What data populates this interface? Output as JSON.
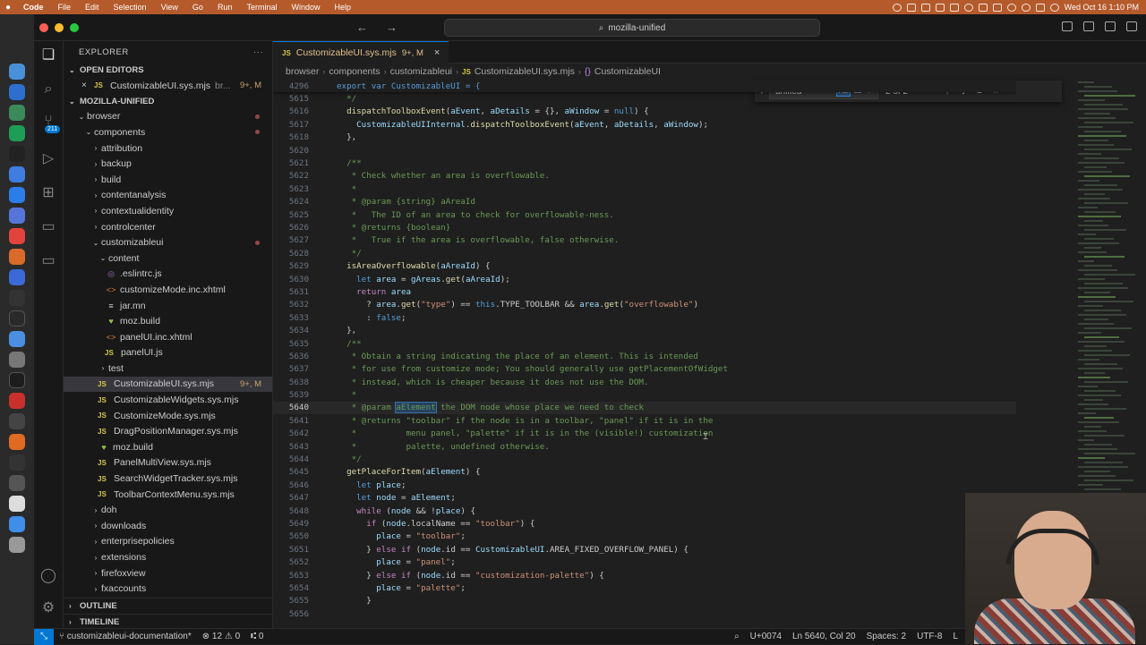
{
  "menubar": {
    "app": "Code",
    "items": [
      "File",
      "Edit",
      "Selection",
      "View",
      "Go",
      "Run",
      "Terminal",
      "Window",
      "Help"
    ],
    "datetime": "Wed Oct 16  1:10 PM"
  },
  "titlebar": {
    "search_text": "mozilla-unified"
  },
  "activity": {
    "scm_badge": "211"
  },
  "sidebar": {
    "title": "EXPLORER",
    "open_editors_label": "OPEN EDITORS",
    "open_editor": {
      "name": "CustomizableUI.sys.mjs",
      "desc": "br...",
      "status": "9+, M"
    },
    "workspace_label": "MOZILLA-UNIFIED",
    "tree": [
      {
        "name": "browser",
        "indent": 1,
        "kind": "folder",
        "open": true,
        "color": "red",
        "dot": true
      },
      {
        "name": "components",
        "indent": 2,
        "kind": "folder",
        "open": true,
        "color": "red",
        "dot": true
      },
      {
        "name": "attribution",
        "indent": 3,
        "kind": "folder",
        "open": false
      },
      {
        "name": "backup",
        "indent": 3,
        "kind": "folder",
        "open": false
      },
      {
        "name": "build",
        "indent": 3,
        "kind": "folder",
        "open": false
      },
      {
        "name": "contentanalysis",
        "indent": 3,
        "kind": "folder",
        "open": false
      },
      {
        "name": "contextualidentity",
        "indent": 3,
        "kind": "folder",
        "open": false
      },
      {
        "name": "controlcenter",
        "indent": 3,
        "kind": "folder",
        "open": false
      },
      {
        "name": "customizableui",
        "indent": 3,
        "kind": "folder",
        "open": true,
        "color": "red",
        "dot": true
      },
      {
        "name": "content",
        "indent": 4,
        "kind": "folder",
        "open": true
      },
      {
        "name": ".eslintrc.js",
        "indent": 5,
        "kind": "eslint"
      },
      {
        "name": "customizeMode.inc.xhtml",
        "indent": 5,
        "kind": "xml"
      },
      {
        "name": "jar.mn",
        "indent": 5,
        "kind": "file"
      },
      {
        "name": "moz.build",
        "indent": 5,
        "kind": "heart"
      },
      {
        "name": "panelUI.inc.xhtml",
        "indent": 5,
        "kind": "xml"
      },
      {
        "name": "panelUI.js",
        "indent": 5,
        "kind": "js"
      },
      {
        "name": "test",
        "indent": 4,
        "kind": "folder",
        "open": false
      },
      {
        "name": "CustomizableUI.sys.mjs",
        "indent": 4,
        "kind": "js",
        "selected": true,
        "meta": "9+, M",
        "color": "mod"
      },
      {
        "name": "CustomizableWidgets.sys.mjs",
        "indent": 4,
        "kind": "js"
      },
      {
        "name": "CustomizeMode.sys.mjs",
        "indent": 4,
        "kind": "js"
      },
      {
        "name": "DragPositionManager.sys.mjs",
        "indent": 4,
        "kind": "js"
      },
      {
        "name": "moz.build",
        "indent": 4,
        "kind": "heart"
      },
      {
        "name": "PanelMultiView.sys.mjs",
        "indent": 4,
        "kind": "js"
      },
      {
        "name": "SearchWidgetTracker.sys.mjs",
        "indent": 4,
        "kind": "js"
      },
      {
        "name": "ToolbarContextMenu.sys.mjs",
        "indent": 4,
        "kind": "js"
      },
      {
        "name": "doh",
        "indent": 3,
        "kind": "folder",
        "open": false
      },
      {
        "name": "downloads",
        "indent": 3,
        "kind": "folder",
        "open": false
      },
      {
        "name": "enterprisepolicies",
        "indent": 3,
        "kind": "folder",
        "open": false
      },
      {
        "name": "extensions",
        "indent": 3,
        "kind": "folder",
        "open": false
      },
      {
        "name": "firefoxview",
        "indent": 3,
        "kind": "folder",
        "open": false
      },
      {
        "name": "fxaccounts",
        "indent": 3,
        "kind": "folder",
        "open": false
      }
    ],
    "outline_label": "OUTLINE",
    "timeline_label": "TIMELINE"
  },
  "editor": {
    "tab": {
      "label": "CustomizableUI.sys.mjs",
      "status": "9+, M"
    },
    "breadcrumbs": [
      "browser",
      "components",
      "customizableui",
      "CustomizableUI.sys.mjs",
      "CustomizableUI"
    ],
    "sticky": {
      "num": "4296",
      "text": "export var CustomizableUI = {"
    },
    "find": {
      "query": "unified",
      "opt_case": "Aa",
      "opt_word": "ab",
      "opt_regex": ".*",
      "count": "2 of 2"
    },
    "lines": [
      {
        "n": "5615",
        "t": "  */",
        "c": "cm"
      },
      {
        "n": "5616",
        "t": "  dispatchToolboxEvent(aEvent, aDetails = {}, aWindow = null) {",
        "c": "mix1"
      },
      {
        "n": "5617",
        "t": "    CustomizableUIInternal.dispatchToolboxEvent(aEvent, aDetails, aWindow);",
        "c": "txt"
      },
      {
        "n": "5618",
        "t": "  },",
        "c": "txt"
      },
      {
        "n": "5620",
        "t": "",
        "c": "txt"
      },
      {
        "n": "5621",
        "t": "  /**",
        "c": "cm"
      },
      {
        "n": "5622",
        "t": "   * Check whether an area is overflowable.",
        "c": "cm"
      },
      {
        "n": "5623",
        "t": "   *",
        "c": "cm"
      },
      {
        "n": "5624",
        "t": "   * @param {string} aAreaId",
        "c": "cm"
      },
      {
        "n": "5625",
        "t": "   *   The ID of an area to check for overflowable-ness.",
        "c": "cm"
      },
      {
        "n": "5626",
        "t": "   * @returns {boolean}",
        "c": "cm"
      },
      {
        "n": "5627",
        "t": "   *   True if the area is overflowable, false otherwise.",
        "c": "cm"
      },
      {
        "n": "5628",
        "t": "   */",
        "c": "cm"
      },
      {
        "n": "5629",
        "t": "  isAreaOverflowable(aAreaId) {",
        "c": "fnline"
      },
      {
        "n": "5630",
        "t": "    let area = gAreas.get(aAreaId);",
        "c": "letline"
      },
      {
        "n": "5631",
        "t": "    return area",
        "c": "ret"
      },
      {
        "n": "5632",
        "t": "      ? area.get(\"type\") == this.TYPE_TOOLBAR && area.get(\"overflowable\")",
        "c": "txt"
      },
      {
        "n": "5633",
        "t": "      : false;",
        "c": "txt"
      },
      {
        "n": "5634",
        "t": "  },",
        "c": "txt"
      },
      {
        "n": "5635",
        "t": "  /**",
        "c": "cm"
      },
      {
        "n": "5636",
        "t": "   * Obtain a string indicating the place of an element. This is intended",
        "c": "cm"
      },
      {
        "n": "5637",
        "t": "   * for use from customize mode; You should generally use getPlacementOfWidget",
        "c": "cm"
      },
      {
        "n": "5638",
        "t": "   * instead, which is cheaper because it does not use the DOM.",
        "c": "cm"
      },
      {
        "n": "5639",
        "t": "   *",
        "c": "cm"
      },
      {
        "n": "5640",
        "t": "   * @param aElement the DOM node whose place we need to check",
        "c": "cur"
      },
      {
        "n": "5641",
        "t": "   * @returns \"toolbar\" if the node is in a toolbar, \"panel\" if it is in the",
        "c": "cm"
      },
      {
        "n": "5642",
        "t": "   *          menu panel, \"palette\" if it is in the (visible!) customization",
        "c": "cm"
      },
      {
        "n": "5643",
        "t": "   *          palette, undefined otherwise.",
        "c": "cm"
      },
      {
        "n": "5644",
        "t": "   */",
        "c": "cm"
      },
      {
        "n": "5645",
        "t": "  getPlaceForItem(aElement) {",
        "c": "fnline2"
      },
      {
        "n": "5646",
        "t": "    let place;",
        "c": "letline"
      },
      {
        "n": "5647",
        "t": "    let node = aElement;",
        "c": "letline"
      },
      {
        "n": "5648",
        "t": "    while (node && !place) {",
        "c": "kwline"
      },
      {
        "n": "5649",
        "t": "      if (node.localName == \"toolbar\") {",
        "c": "kwline"
      },
      {
        "n": "5650",
        "t": "        place = \"toolbar\";",
        "c": "txt"
      },
      {
        "n": "5651",
        "t": "      } else if (node.id == CustomizableUI.AREA_FIXED_OVERFLOW_PANEL) {",
        "c": "kwline"
      },
      {
        "n": "5652",
        "t": "        place = \"panel\";",
        "c": "txt"
      },
      {
        "n": "5653",
        "t": "      } else if (node.id == \"customization-palette\") {",
        "c": "kwline"
      },
      {
        "n": "5654",
        "t": "        place = \"palette\";",
        "c": "txt"
      },
      {
        "n": "5655",
        "t": "      }",
        "c": "txt"
      },
      {
        "n": "5656",
        "t": "",
        "c": "txt"
      }
    ]
  },
  "statusbar": {
    "branch": "customizableui-documentation*",
    "problems": "12",
    "warnings": "0",
    "ports": "0",
    "unicode": "U+0074",
    "position": "Ln 5640, Col 20",
    "spaces": "Spaces: 2",
    "encoding": "UTF-8",
    "trailing": "L"
  },
  "colors": {
    "accent": "#0078d4",
    "menubar": "#b55a2b",
    "modified": "#e2c08d",
    "untracked": "#d57d70",
    "comment": "#6a9955"
  }
}
